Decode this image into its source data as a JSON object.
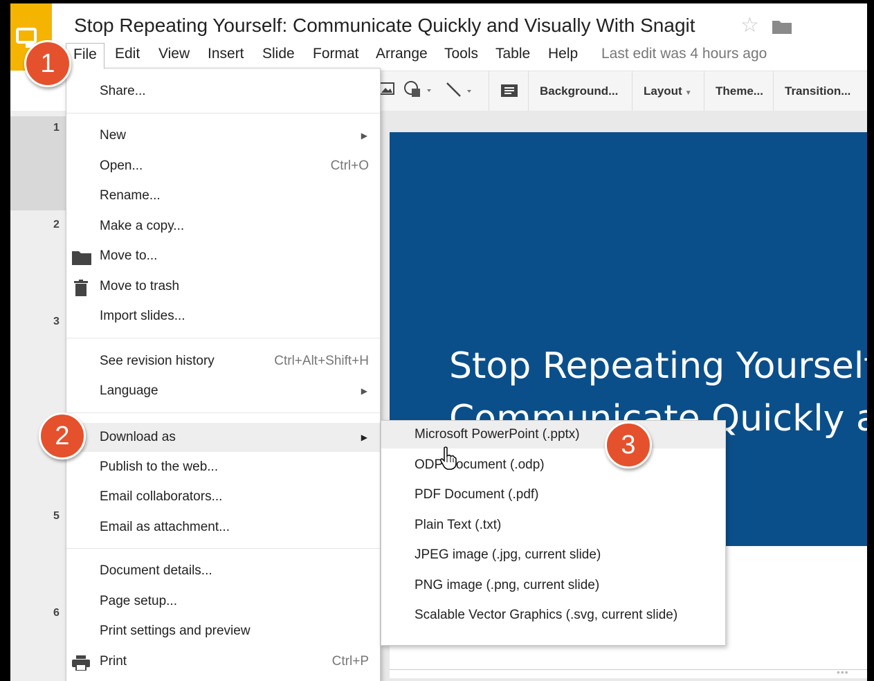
{
  "header": {
    "title": "Stop Repeating Yourself: Communicate Quickly and Visually With Snagit",
    "last_edit": "Last edit was 4 hours ago"
  },
  "menubar": [
    "File",
    "Edit",
    "View",
    "Insert",
    "Slide",
    "Format",
    "Arrange",
    "Tools",
    "Table",
    "Help"
  ],
  "toolbar": {
    "background": "Background...",
    "layout": "Layout",
    "theme": "Theme...",
    "transition": "Transition..."
  },
  "filmstrip": {
    "slide_numbers": [
      "1",
      "2",
      "3",
      "5",
      "6"
    ]
  },
  "slide": {
    "title_line1": "Stop Repeating Yourself:",
    "title_line2": "Communicate Quickly an"
  },
  "file_menu": {
    "share": "Share...",
    "new": "New",
    "open": "Open...",
    "open_shortcut": "Ctrl+O",
    "rename": "Rename...",
    "make_copy": "Make a copy...",
    "move_to": "Move to...",
    "move_to_trash": "Move to trash",
    "import_slides": "Import slides...",
    "revision_history": "See revision history",
    "revision_shortcut": "Ctrl+Alt+Shift+H",
    "language": "Language",
    "download_as": "Download as",
    "publish": "Publish to the web...",
    "email_collaborators": "Email collaborators...",
    "email_attachment": "Email as attachment...",
    "document_details": "Document details...",
    "page_setup": "Page setup...",
    "print_settings": "Print settings and preview",
    "print": "Print",
    "print_shortcut": "Ctrl+P"
  },
  "download_submenu": [
    "Microsoft PowerPoint (.pptx)",
    "ODP Document (.odp)",
    "PDF Document (.pdf)",
    "Plain Text (.txt)",
    "JPEG image (.jpg, current slide)",
    "PNG image (.png, current slide)",
    "Scalable Vector Graphics (.svg, current slide)"
  ],
  "callouts": [
    "1",
    "2",
    "3"
  ],
  "colors": {
    "logo": "#f4b400",
    "slide": "#0b4f8a",
    "callout": "#e5512c"
  }
}
